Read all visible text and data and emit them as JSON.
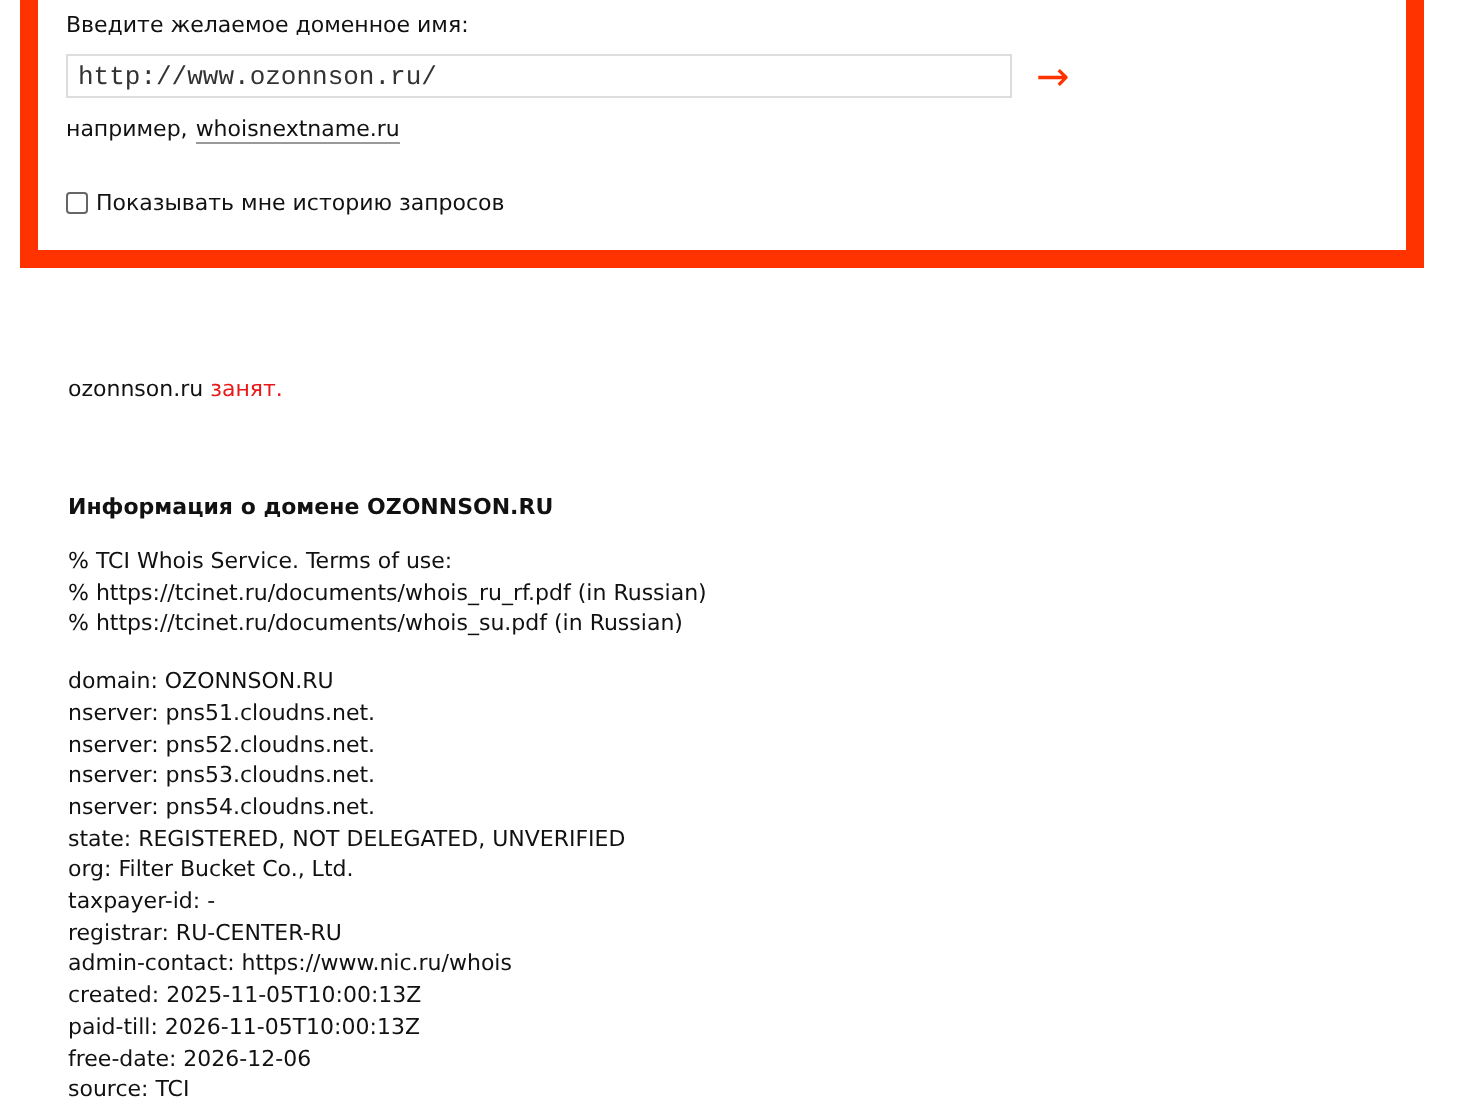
{
  "search_form": {
    "label": "Введите желаемое доменное имя:",
    "domain_field": {
      "value": "http://www.ozonnson.ru/"
    },
    "submit_arrow": "→",
    "example": {
      "prefix": "например,",
      "link": "whoisnextname.ru"
    },
    "history_checkbox": {
      "label": "Показывать мне историю запросов",
      "checked": false
    }
  },
  "result": {
    "domain": "ozonnson.ru",
    "status": "занят."
  },
  "info": {
    "heading": "Информация о домене OZONNSON.RU",
    "blocks": [
      [
        "% TCI Whois Service. Terms of use:",
        "% https://tcinet.ru/documents/whois_ru_rf.pdf (in Russian)",
        "% https://tcinet.ru/documents/whois_su.pdf (in Russian)"
      ],
      [
        "domain: OZONNSON.RU",
        "nserver: pns51.cloudns.net.",
        "nserver: pns52.cloudns.net.",
        "nserver: pns53.cloudns.net.",
        "nserver: pns54.cloudns.net.",
        "state: REGISTERED, NOT DELEGATED, UNVERIFIED",
        "org: Filter Bucket Co., Ltd.",
        "taxpayer-id: -",
        "registrar: RU-CENTER-RU",
        "admin-contact: https://www.nic.ru/whois",
        "created: 2025-11-05T10:00:13Z",
        "paid-till: 2026-11-05T10:00:13Z",
        "free-date: 2026-12-06",
        "source: TCI"
      ]
    ]
  }
}
